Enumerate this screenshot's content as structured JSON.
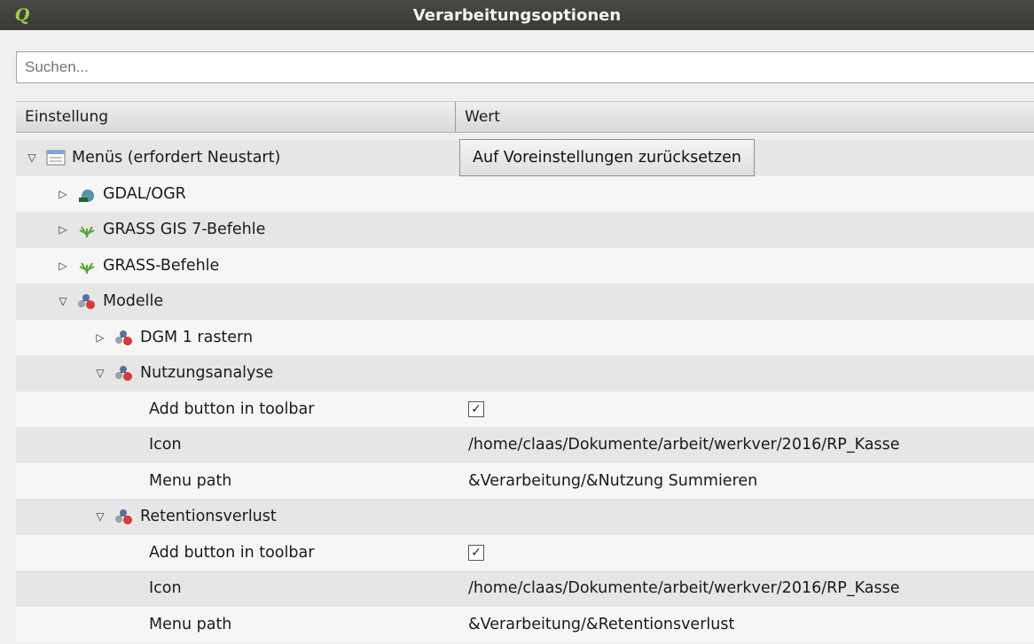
{
  "window": {
    "title": "Verarbeitungsoptionen",
    "app_icon": "qgis-icon",
    "app_icon_letter": "Q"
  },
  "search": {
    "placeholder": "Suchen..."
  },
  "table": {
    "headers": [
      "Einstellung",
      "Wert"
    ],
    "rows": [
      {
        "label": "Menüs (erfordert Neustart)",
        "expanded": true,
        "icon": "menu-list-icon",
        "button": "Auf Voreinstellungen zurücksetzen"
      },
      {
        "label": "GDAL/OGR",
        "expanded": false,
        "icon": "gdal-icon"
      },
      {
        "label": "GRASS GIS 7-Befehle",
        "expanded": false,
        "icon": "grass-icon"
      },
      {
        "label": "GRASS-Befehle",
        "expanded": false,
        "icon": "grass-icon"
      },
      {
        "label": "Modelle",
        "expanded": true,
        "icon": "model-icon"
      },
      {
        "label": "DGM 1 rastern",
        "expanded": false,
        "icon": "model-icon"
      },
      {
        "label": "Nutzungsanalyse",
        "expanded": true,
        "icon": "model-icon"
      },
      {
        "label": "Add button in toolbar",
        "checkbox": true,
        "checked": true
      },
      {
        "label": "Icon",
        "value": "/home/claas/Dokumente/arbeit/werkver/2016/RP_Kasse"
      },
      {
        "label": "Menu path",
        "value": "&Verarbeitung/&Nutzung Summieren"
      },
      {
        "label": "Retentionsverlust",
        "expanded": true,
        "icon": "model-icon"
      },
      {
        "label": "Add button in toolbar",
        "checkbox": true,
        "checked": true
      },
      {
        "label": "Icon",
        "value": "/home/claas/Dokumente/arbeit/werkver/2016/RP_Kasse"
      },
      {
        "label": "Menu path",
        "value": "&Verarbeitung/&Retentionsverlust"
      }
    ]
  },
  "glyphs": {
    "expanded": "▽",
    "collapsed": "▷",
    "check": "✓"
  }
}
